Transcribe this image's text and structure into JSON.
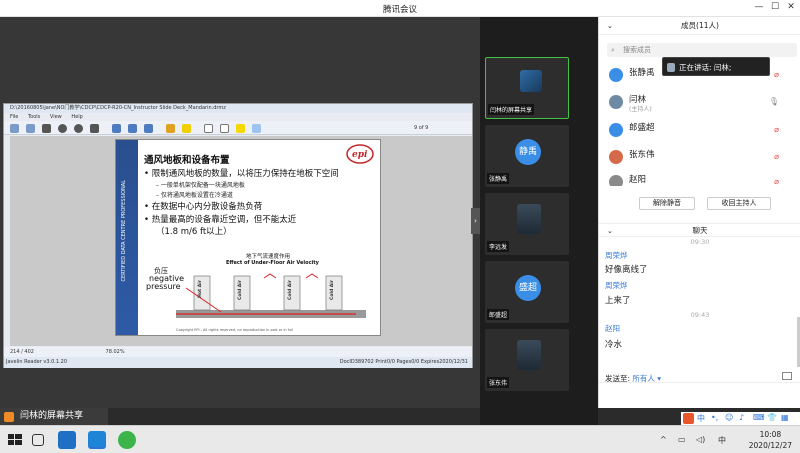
{
  "window": {
    "title": "腾讯会议",
    "minimize": "—",
    "maximize": "☐",
    "close": "✕"
  },
  "pdf": {
    "title": "D:\\20160805\\jane\\NO门教学\\CDCP\\CDCP-R20-CN_Instructor Slide Deck_Mandarin.drmz",
    "menu": [
      "File",
      "Tools",
      "View",
      "Help"
    ],
    "page_info": "9 of 9",
    "page_nav": "214 / 402",
    "zoom": "78.02%",
    "status_left": "Javelin Reader v3.0.1.20",
    "status_right": "DocID389702 Print0/0 Pages0/0 Expires2020/12/31",
    "slide": {
      "title": "通风地板和设备布置",
      "bullets": [
        "限制通风地板的数量，以将压力保持在地板下空间",
        "在数据中心内分散设备热负荷",
        "热量最高的设备靠近空调，但不能太近"
      ],
      "sub1": "一般单机架仅配备一块通风地板",
      "sub2": "仅将通风地板设置在冷通道",
      "note": "（1.8 m/6 ft以上）",
      "side_text": "CERTIFIED DATA CENTRE PROFESSIONAL",
      "diagram_cn": "地下气流速度作用",
      "diagram_en": "Effect of Under-Floor Air Velocity",
      "neg_cn": "负压",
      "neg_en1": "negative",
      "neg_en2": "pressure",
      "rack_labels": [
        "Hot Air",
        "Cold Air",
        "Cold Air",
        "Cold Air"
      ],
      "copyright": "Copyright EPI - All rights reserved, no reproduction in part or in full"
    }
  },
  "speaker_banner": "闫林的屏幕共享",
  "videos": [
    {
      "label": "闫林的屏幕共享",
      "type": "screen"
    },
    {
      "label": "张静禹",
      "avatar": "静禹",
      "color": "#3a8ee6"
    },
    {
      "label": "李远发",
      "type": "photo"
    },
    {
      "label": "郎盛超",
      "avatar": "盛超",
      "color": "#3a8ee6"
    },
    {
      "label": "张东伟",
      "type": "photo"
    }
  ],
  "members": {
    "header": "成员(11人)",
    "search_placeholder": "搜索成员",
    "list": [
      {
        "name": "张静禹",
        "role": "",
        "color": "#3a8ee6",
        "muted": true
      },
      {
        "name": "闫林",
        "role": "(主持人)",
        "color": "#6f8aa3",
        "muted": false
      },
      {
        "name": "郎盛超",
        "role": "",
        "color": "#3a8ee6",
        "muted": true
      },
      {
        "name": "张东伟",
        "role": "",
        "color": "#d46a4a",
        "muted": true
      },
      {
        "name": "赵阳",
        "role": "",
        "color": "#8a8a8a",
        "muted": true
      }
    ],
    "unmute_btn": "解除静音",
    "reclaim_btn": "收回主持人"
  },
  "speaking_popup": "正在讲话: 闫林;",
  "chat": {
    "header": "聊天",
    "messages": [
      {
        "time": "09:30",
        "name": "周荣烨",
        "text": "好像离线了"
      },
      {
        "time": "",
        "name": "周荣烨",
        "text": "上来了"
      },
      {
        "time": "09:43",
        "name": "赵阳",
        "text": "冷水"
      }
    ],
    "send_to_label": "发送至:",
    "send_to_target": "所有人 ▾"
  },
  "taskbar": {
    "time": "10:08",
    "date": "2020/12/27",
    "ime": "中"
  },
  "colors": {
    "accent": "#3a8ee6",
    "muted_red": "#e44444",
    "link_blue": "#3a7bd5"
  }
}
